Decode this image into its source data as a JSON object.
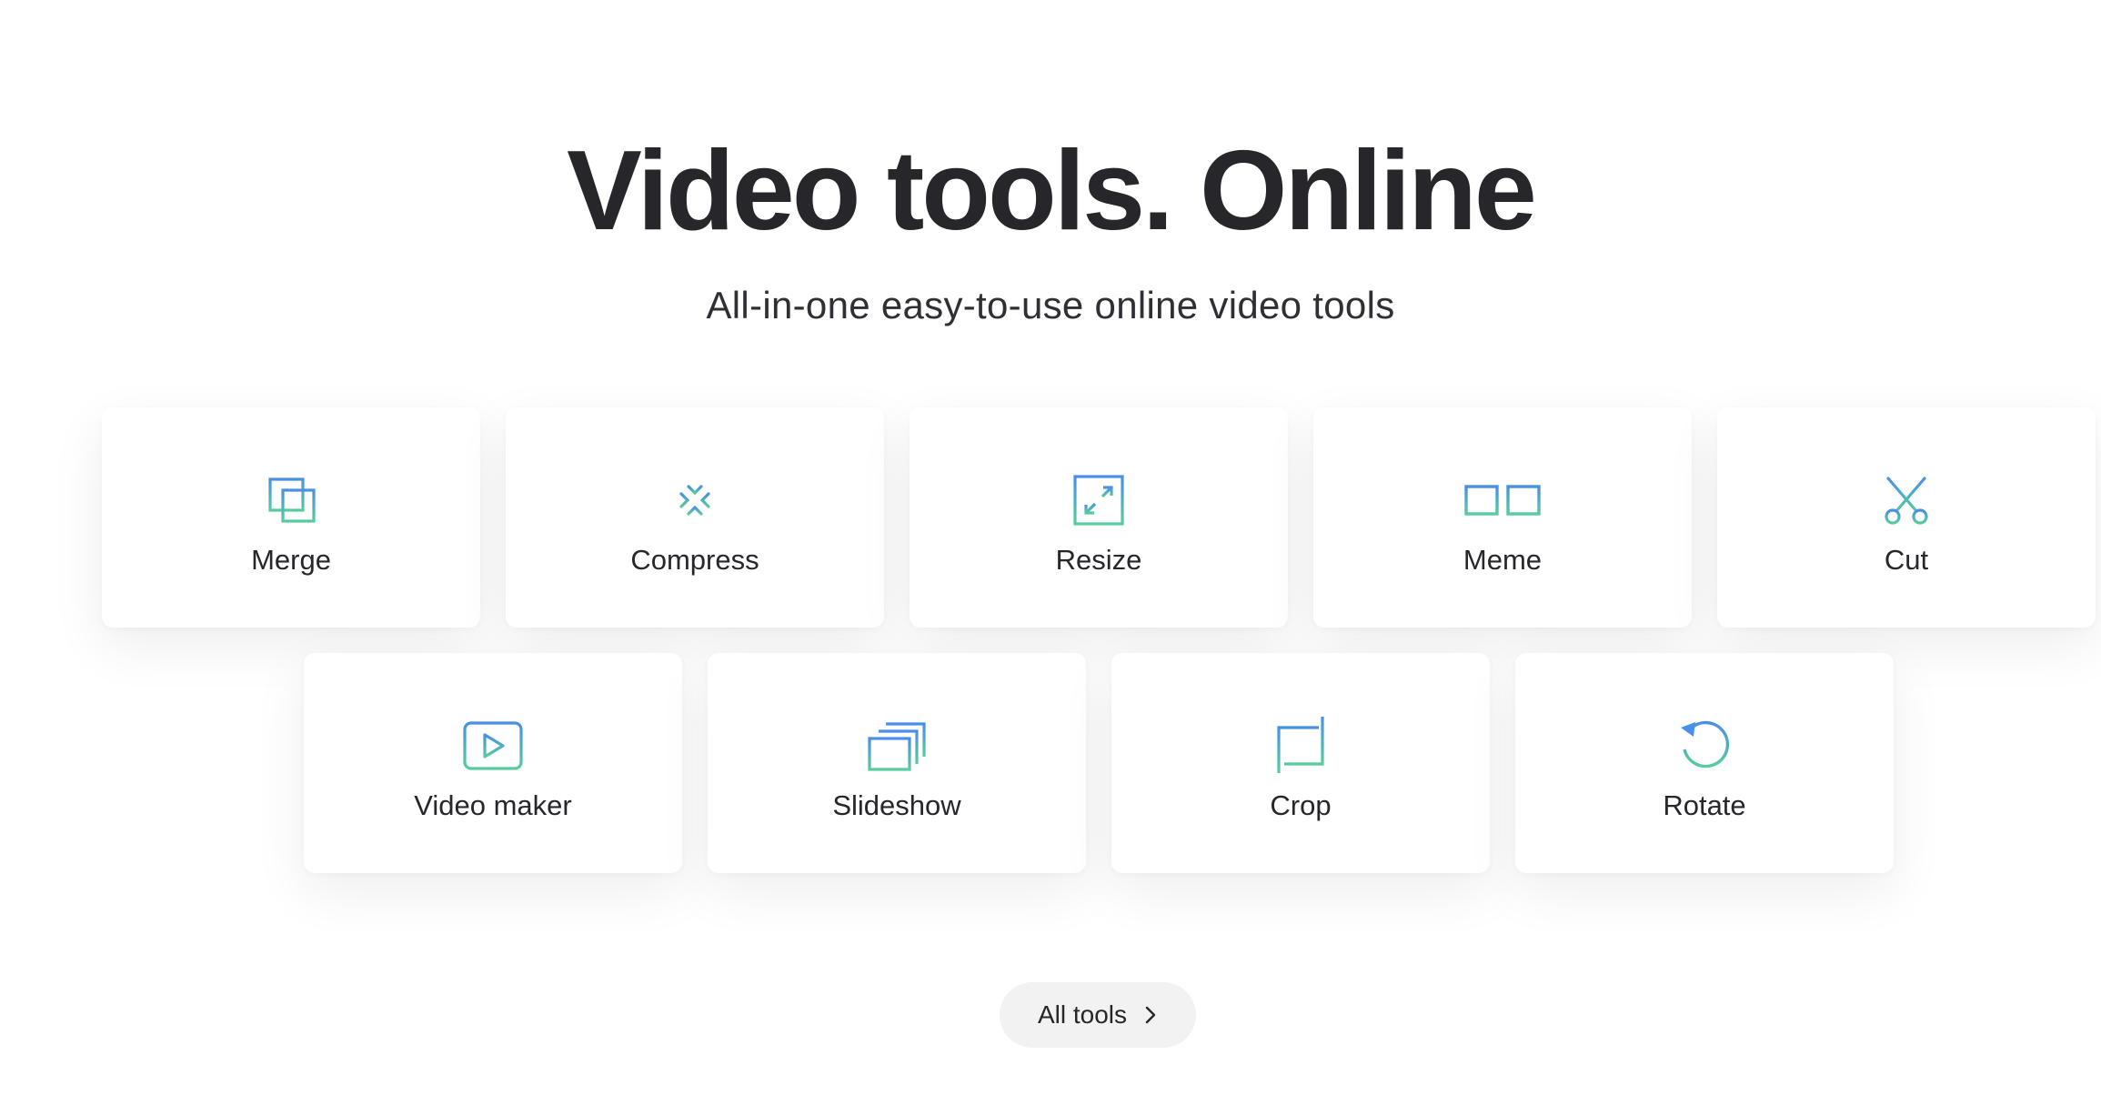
{
  "hero": {
    "title": "Video tools. Online",
    "subtitle": "All-in-one easy-to-use online video tools"
  },
  "colors": {
    "gradient_top": "#4a8fe6",
    "gradient_bottom": "#56cc9d",
    "text": "#26262b",
    "button_bg": "#f2f2f2"
  },
  "tools": [
    {
      "label": "Merge",
      "icon": "merge-icon"
    },
    {
      "label": "Compress",
      "icon": "compress-icon"
    },
    {
      "label": "Resize",
      "icon": "resize-icon"
    },
    {
      "label": "Meme",
      "icon": "glasses-icon"
    },
    {
      "label": "Cut",
      "icon": "scissors-icon"
    },
    {
      "label": "Video maker",
      "icon": "play-icon"
    },
    {
      "label": "Slideshow",
      "icon": "slideshow-icon"
    },
    {
      "label": "Crop",
      "icon": "crop-icon"
    },
    {
      "label": "Rotate",
      "icon": "rotate-icon"
    }
  ],
  "all_tools_button": {
    "label": "All tools",
    "icon": "chevron-right-icon"
  }
}
